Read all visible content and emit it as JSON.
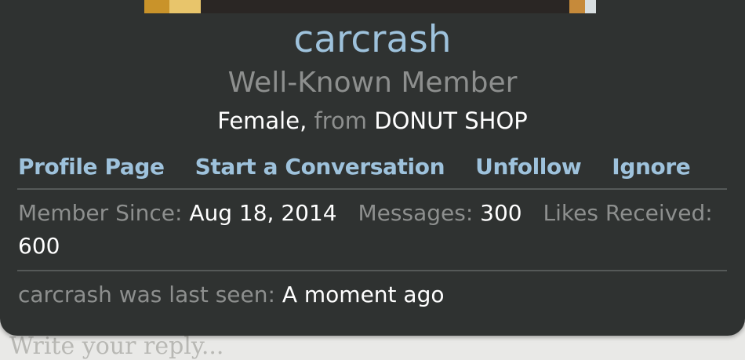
{
  "background": {
    "editor_placeholder": "Write your reply..."
  },
  "profile": {
    "username": "carcrash",
    "user_title": "Well-Known Member",
    "gender": "Female,",
    "from_label": "from",
    "location": "DONUT SHOP"
  },
  "actions": {
    "profile_page": "Profile Page",
    "start_conversation": "Start a Conversation",
    "unfollow": "Unfollow",
    "ignore": "Ignore"
  },
  "stats": {
    "member_since_label": "Member Since:",
    "member_since_value": "Aug 18, 2014",
    "messages_label": "Messages:",
    "messages_value": "300",
    "likes_label": "Likes Received:",
    "likes_value": "600"
  },
  "last_seen": {
    "label": "carcrash was last seen:",
    "value": "A moment ago"
  },
  "colors": {
    "card_background": "#2f3231",
    "accent_link": "#9ec2dc",
    "muted_text": "#8d8f8e",
    "divider": "#555958"
  }
}
